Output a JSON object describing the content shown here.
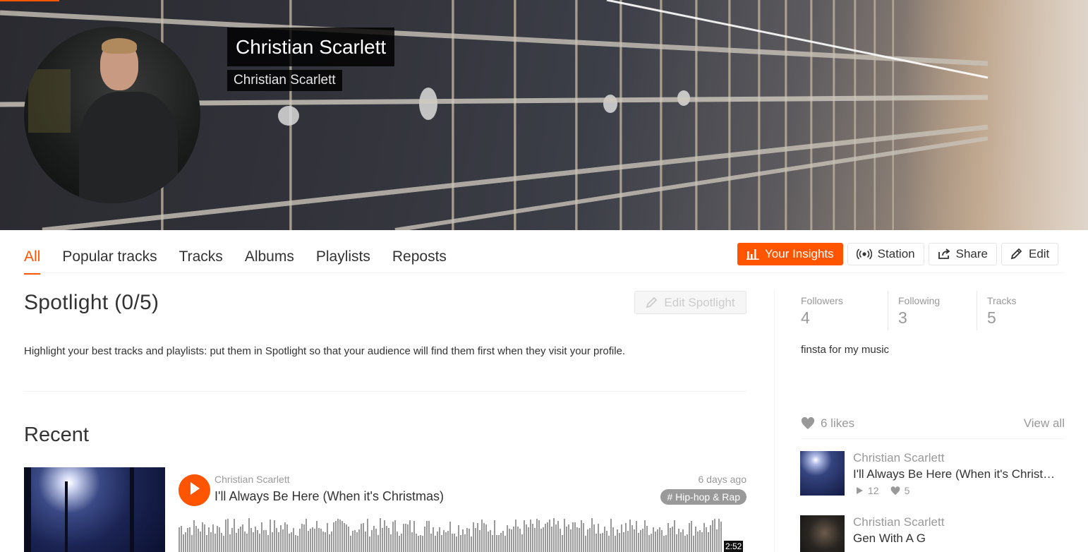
{
  "colors": {
    "accent": "#ff5500",
    "muted": "#999999",
    "text": "#333333"
  },
  "profile": {
    "display_name": "Christian Scarlett",
    "username": "Christian Scarlett",
    "bio": "finsta for my music"
  },
  "tabs": [
    {
      "label": "All",
      "active": true
    },
    {
      "label": "Popular tracks",
      "active": false
    },
    {
      "label": "Tracks",
      "active": false
    },
    {
      "label": "Albums",
      "active": false
    },
    {
      "label": "Playlists",
      "active": false
    },
    {
      "label": "Reposts",
      "active": false
    }
  ],
  "actions": {
    "insights": {
      "label": "Your Insights",
      "icon": "bar-chart-icon"
    },
    "station": {
      "label": "Station",
      "icon": "broadcast-icon"
    },
    "share": {
      "label": "Share",
      "icon": "share-icon"
    },
    "edit": {
      "label": "Edit",
      "icon": "pencil-icon"
    }
  },
  "spotlight": {
    "title": "Spotlight (0/5)",
    "edit_label": "Edit Spotlight",
    "description": "Highlight your best tracks and playlists: put them in Spotlight so that your audience will find them first when they visit your profile."
  },
  "recent": {
    "title": "Recent",
    "track": {
      "user": "Christian Scarlett",
      "title": "I'll Always Be Here (When it's Christmas)",
      "posted": "6 days ago",
      "genre": "# Hip-hop & Rap",
      "duration": "2:52"
    }
  },
  "stats": [
    {
      "label": "Followers",
      "value": "4"
    },
    {
      "label": "Following",
      "value": "3"
    },
    {
      "label": "Tracks",
      "value": "5"
    }
  ],
  "likes": {
    "count_label": "6 likes",
    "view_all": "View all",
    "items": [
      {
        "user": "Christian Scarlett",
        "title": "I'll Always Be Here (When it's Christmas)",
        "plays": "12",
        "likes": "5"
      },
      {
        "user": "Christian Scarlett",
        "title": "Gen With A G",
        "plays": "",
        "likes": ""
      }
    ]
  }
}
